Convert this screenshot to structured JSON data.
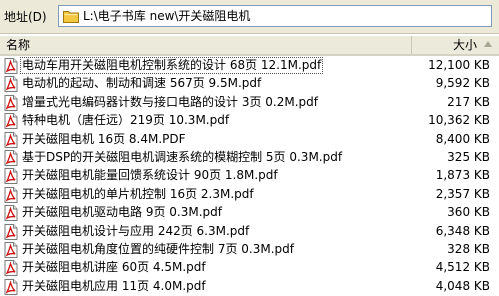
{
  "address": {
    "label": "地址(D)",
    "path": "L:\\电子书库 new\\开关磁阻电机"
  },
  "columns": {
    "name": "名称",
    "size": "大小"
  },
  "files": [
    {
      "name": "电动车用开关磁阻电机控制系统的设计 68页 12.1M.pdf",
      "size": "12,100 KB"
    },
    {
      "name": "电动机的起动、制动和调速 567页 9.5M.pdf",
      "size": "9,592 KB"
    },
    {
      "name": "增量式光电编码器计数与接口电路的设计 3页 0.2M.pdf",
      "size": "217 KB"
    },
    {
      "name": "特种电机（唐任远）219页 10.3M.pdf",
      "size": "10,362 KB"
    },
    {
      "name": "开关磁阻电机 16页 8.4M.PDF",
      "size": "8,400 KB"
    },
    {
      "name": "基于DSP的开关磁阻电机调速系统的模糊控制 5页 0.3M.pdf",
      "size": "325 KB"
    },
    {
      "name": "开关磁阻电机能量回馈系统设计 90页 1.8M.pdf",
      "size": "1,873 KB"
    },
    {
      "name": "开关磁阻电机的单片机控制 16页 2.3M.pdf",
      "size": "2,357 KB"
    },
    {
      "name": "开关磁阻电机驱动电路 9页 0.3M.pdf",
      "size": "360 KB"
    },
    {
      "name": "开关磁阻电机设计与应用 242页 6.3M.pdf",
      "size": "6,348 KB"
    },
    {
      "name": "开关磁阻电机角度位置的纯硬件控制 7页 0.3M.pdf",
      "size": "328 KB"
    },
    {
      "name": "开关磁阻电机讲座 60页 4.5M.pdf",
      "size": "4,512 KB"
    },
    {
      "name": "开关磁阻电机应用 11页 4.0M.pdf",
      "size": "4,048 KB"
    }
  ],
  "icons": {
    "file": "pdf-file-icon",
    "folder": "folder-icon",
    "sort": "sort-ascending-icon"
  },
  "colors": {
    "pdf_red": "#cc1111",
    "folder_yellow": "#f5c842"
  }
}
